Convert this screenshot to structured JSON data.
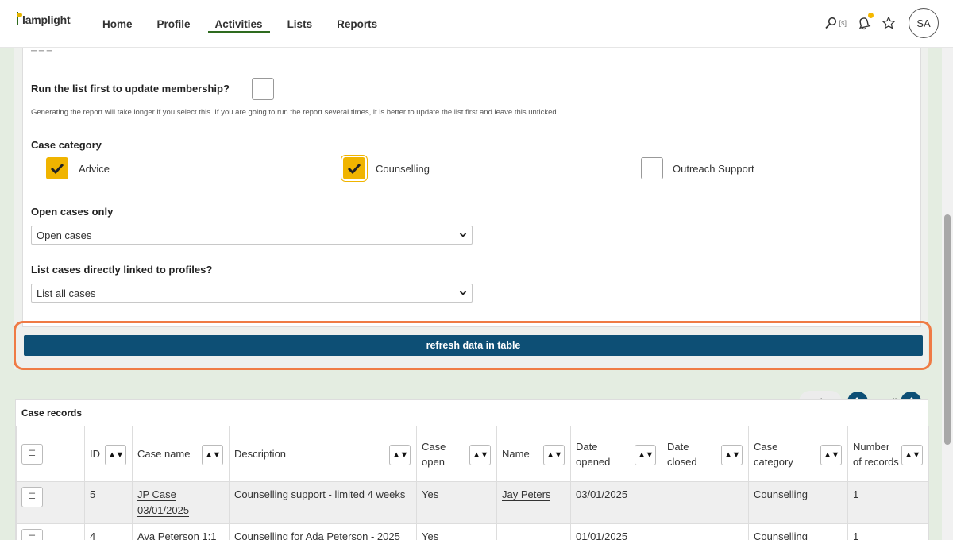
{
  "nav": {
    "logo": "lamplight",
    "items": [
      {
        "label": "Home"
      },
      {
        "label": "Profile"
      },
      {
        "label": "Activities"
      },
      {
        "label": "Lists"
      },
      {
        "label": "Reports"
      }
    ],
    "search_shortcut": "[s]",
    "avatar_initials": "SA"
  },
  "form": {
    "run_list_label": "Run the list first to update membership?",
    "run_list_help": "Generating the report will take longer if you select this. If you are going to run the report several times, it is better to update the list first and leave this unticked.",
    "case_category_label": "Case category",
    "categories": [
      {
        "label": "Advice",
        "checked": true
      },
      {
        "label": "Counselling",
        "checked": true
      },
      {
        "label": "Outreach Support",
        "checked": false
      }
    ],
    "open_cases_label": "Open cases only",
    "open_cases_value": "Open cases",
    "linked_label": "List cases directly linked to profiles?",
    "linked_value": "List all cases",
    "refresh_label": "refresh data in table"
  },
  "table": {
    "title": "Case records",
    "pager": "1 / 1",
    "scroll_label": "Scroll",
    "columns": [
      "ID",
      "Case name",
      "Description",
      "Case open",
      "Name",
      "Date opened",
      "Date closed",
      "Case category",
      "Number of records"
    ],
    "rows": [
      {
        "id": "5",
        "case_name": "JP Case 03/01/2025",
        "description": "Counselling support - limited 4 weeks",
        "open": "Yes",
        "name": "Jay Peters",
        "opened": "03/01/2025",
        "closed": "",
        "category": "Counselling",
        "records": "1"
      },
      {
        "id": "4",
        "case_name": "Ava Peterson 1:1",
        "description": "Counselling for Ada Peterson - 2025",
        "open": "Yes",
        "name": "",
        "opened": "01/01/2025",
        "closed": "",
        "category": "Counselling",
        "records": "1"
      }
    ]
  },
  "colors": {
    "accent": "#f0b400",
    "primary": "#0d4f75",
    "highlight": "#ef7b45",
    "nav_active": "#2e6b1f"
  }
}
